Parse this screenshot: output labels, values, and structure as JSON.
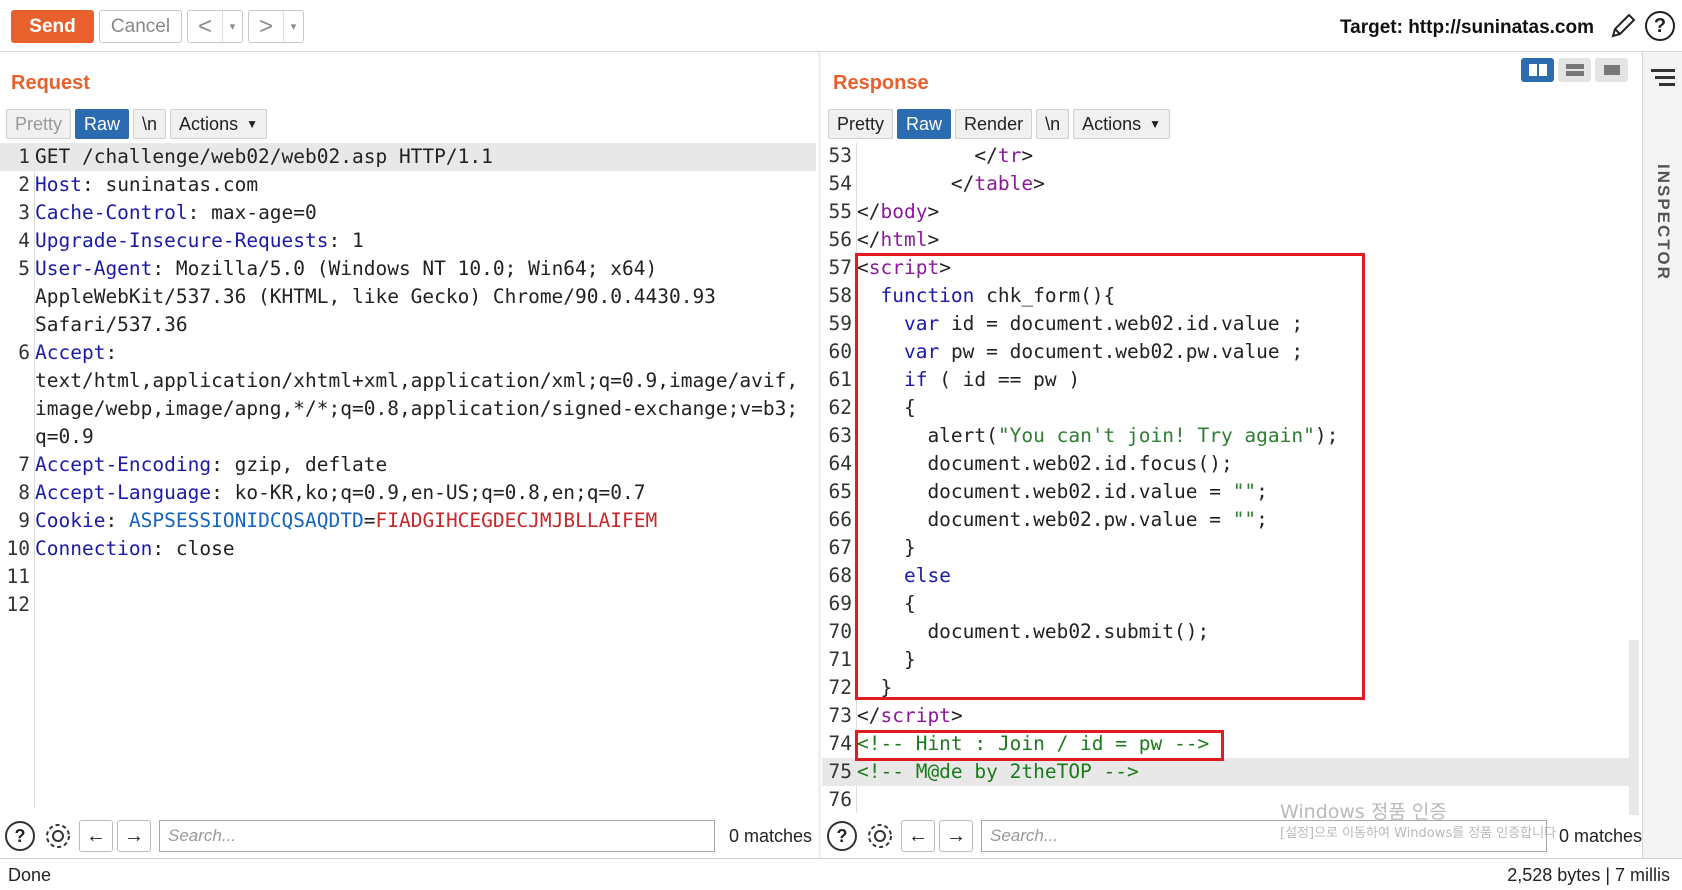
{
  "toolbar": {
    "send_label": "Send",
    "cancel_label": "Cancel",
    "back_label": "<",
    "forward_label": ">",
    "dropdown_glyph": "▾",
    "target_label": "Target: http://suninatas.com",
    "help_glyph": "?"
  },
  "request": {
    "title": "Request",
    "tabs": [
      "Pretty",
      "Raw",
      "\\n",
      "Actions"
    ],
    "lines": [
      {
        "n": "1",
        "segs": [
          [
            "GET /challenge/web02/web02.asp HTTP/1.1",
            ""
          ]
        ],
        "hl": true
      },
      {
        "n": "2",
        "segs": [
          [
            "Host",
            "c-key"
          ],
          [
            ": suninatas.com",
            ""
          ]
        ]
      },
      {
        "n": "3",
        "segs": [
          [
            "Cache-Control",
            "c-key"
          ],
          [
            ": max-age=0",
            ""
          ]
        ]
      },
      {
        "n": "4",
        "segs": [
          [
            "Upgrade-Insecure-Requests",
            "c-key"
          ],
          [
            ": 1",
            ""
          ]
        ]
      },
      {
        "n": "5",
        "segs": [
          [
            "User-Agent",
            "c-key"
          ],
          [
            ": Mozilla/5.0 (Windows NT 10.0; Win64; x64)",
            ""
          ]
        ]
      },
      {
        "n": "",
        "segs": [
          [
            "AppleWebKit/537.36 (KHTML, like Gecko) Chrome/90.0.4430.93",
            ""
          ]
        ]
      },
      {
        "n": "",
        "segs": [
          [
            "Safari/537.36",
            ""
          ]
        ]
      },
      {
        "n": "6",
        "segs": [
          [
            "Accept",
            "c-key"
          ],
          [
            ":",
            ""
          ]
        ]
      },
      {
        "n": "",
        "segs": [
          [
            "text/html,application/xhtml+xml,application/xml;q=0.9,image/avif,",
            ""
          ]
        ]
      },
      {
        "n": "",
        "segs": [
          [
            "image/webp,image/apng,*/*;q=0.8,application/signed-exchange;v=b3;",
            ""
          ]
        ]
      },
      {
        "n": "",
        "segs": [
          [
            "q=0.9",
            ""
          ]
        ]
      },
      {
        "n": "7",
        "segs": [
          [
            "Accept-Encoding",
            "c-key"
          ],
          [
            ": gzip, deflate",
            ""
          ]
        ]
      },
      {
        "n": "8",
        "segs": [
          [
            "Accept-Language",
            "c-key"
          ],
          [
            ": ko-KR,ko;q=0.9,en-US;q=0.8,en;q=0.7",
            ""
          ]
        ]
      },
      {
        "n": "9",
        "segs": [
          [
            "Cookie",
            "c-key"
          ],
          [
            ": ",
            ""
          ],
          [
            "ASPSESSIONIDCQSAQDTD",
            "c-blue"
          ],
          [
            "=",
            ""
          ],
          [
            "FIADGIHCEGDECJMJBLLAIFEM",
            "c-red"
          ]
        ]
      },
      {
        "n": "10",
        "segs": [
          [
            "Connection",
            "c-key"
          ],
          [
            ": close",
            ""
          ]
        ]
      },
      {
        "n": "11",
        "segs": [
          [
            "",
            ""
          ]
        ]
      },
      {
        "n": "12",
        "segs": [
          [
            "",
            ""
          ]
        ]
      }
    ],
    "search_placeholder": "Search...",
    "matches": "0 matches"
  },
  "response": {
    "title": "Response",
    "tabs": [
      "Pretty",
      "Raw",
      "Render",
      "\\n",
      "Actions"
    ],
    "lines": [
      {
        "n": "53",
        "segs": [
          [
            "          </",
            ""
          ],
          [
            "tr",
            "c-tag"
          ],
          [
            ">",
            ""
          ]
        ]
      },
      {
        "n": "54",
        "segs": [
          [
            "        </",
            ""
          ],
          [
            "table",
            "c-tag"
          ],
          [
            ">",
            ""
          ]
        ]
      },
      {
        "n": "55",
        "segs": [
          [
            "</",
            ""
          ],
          [
            "body",
            "c-tag"
          ],
          [
            ">",
            ""
          ]
        ]
      },
      {
        "n": "56",
        "segs": [
          [
            "</",
            ""
          ],
          [
            "html",
            "c-tag"
          ],
          [
            ">",
            ""
          ]
        ]
      },
      {
        "n": "57",
        "segs": [
          [
            "<",
            ""
          ],
          [
            "script",
            "c-tag"
          ],
          [
            ">",
            ""
          ]
        ]
      },
      {
        "n": "58",
        "segs": [
          [
            "  ",
            ""
          ],
          [
            "function",
            "c-kw"
          ],
          [
            " chk_form(){",
            ""
          ]
        ]
      },
      {
        "n": "59",
        "segs": [
          [
            "    ",
            ""
          ],
          [
            "var",
            "c-kw"
          ],
          [
            " id = document.web02.id.value ;",
            ""
          ]
        ]
      },
      {
        "n": "60",
        "segs": [
          [
            "    ",
            ""
          ],
          [
            "var",
            "c-kw"
          ],
          [
            " pw = document.web02.pw.value ;",
            ""
          ]
        ]
      },
      {
        "n": "61",
        "segs": [
          [
            "    ",
            ""
          ],
          [
            "if",
            "c-kw"
          ],
          [
            " ( id == pw )",
            ""
          ]
        ]
      },
      {
        "n": "62",
        "segs": [
          [
            "    {",
            ""
          ]
        ]
      },
      {
        "n": "63",
        "segs": [
          [
            "      alert(",
            ""
          ],
          [
            "\"You can't join! Try again\"",
            "c-str"
          ],
          [
            ");",
            ""
          ]
        ]
      },
      {
        "n": "64",
        "segs": [
          [
            "      document.web02.id.focus();",
            ""
          ]
        ]
      },
      {
        "n": "65",
        "segs": [
          [
            "      document.web02.id.value = ",
            ""
          ],
          [
            "\"\"",
            "c-str"
          ],
          [
            ";",
            ""
          ]
        ]
      },
      {
        "n": "66",
        "segs": [
          [
            "      document.web02.pw.value = ",
            ""
          ],
          [
            "\"\"",
            "c-str"
          ],
          [
            ";",
            ""
          ]
        ]
      },
      {
        "n": "67",
        "segs": [
          [
            "    }",
            ""
          ]
        ]
      },
      {
        "n": "68",
        "segs": [
          [
            "    ",
            ""
          ],
          [
            "else",
            "c-kw"
          ]
        ]
      },
      {
        "n": "69",
        "segs": [
          [
            "    {",
            ""
          ]
        ]
      },
      {
        "n": "70",
        "segs": [
          [
            "      document.web02.submit();",
            ""
          ]
        ]
      },
      {
        "n": "71",
        "segs": [
          [
            "    }",
            ""
          ]
        ]
      },
      {
        "n": "72",
        "segs": [
          [
            "  }",
            ""
          ]
        ]
      },
      {
        "n": "73",
        "segs": [
          [
            "</",
            ""
          ],
          [
            "script",
            "c-tag"
          ],
          [
            ">",
            ""
          ]
        ]
      },
      {
        "n": "74",
        "segs": [
          [
            "<!-- Hint : Join / id = pw -->",
            "c-cmt"
          ]
        ]
      },
      {
        "n": "75",
        "segs": [
          [
            "<!-- M@de by 2theTOP -->",
            "c-cmt"
          ]
        ],
        "hl": true
      },
      {
        "n": "76",
        "segs": [
          [
            "",
            ""
          ]
        ]
      }
    ],
    "search_placeholder": "Search...",
    "matches": "0 matches"
  },
  "inspector": {
    "label": "INSPECTOR"
  },
  "status": {
    "left": "Done",
    "right": "2,528 bytes | 7 millis"
  },
  "watermark": {
    "line1": "Windows 정품 인증",
    "line2": "[설정]으로 이동하여 Windows를 정품 인증합니다."
  },
  "colors": {
    "accent": "#e8602c",
    "tab_active": "#2b6cb0",
    "highlight_box": "#e21b23"
  }
}
